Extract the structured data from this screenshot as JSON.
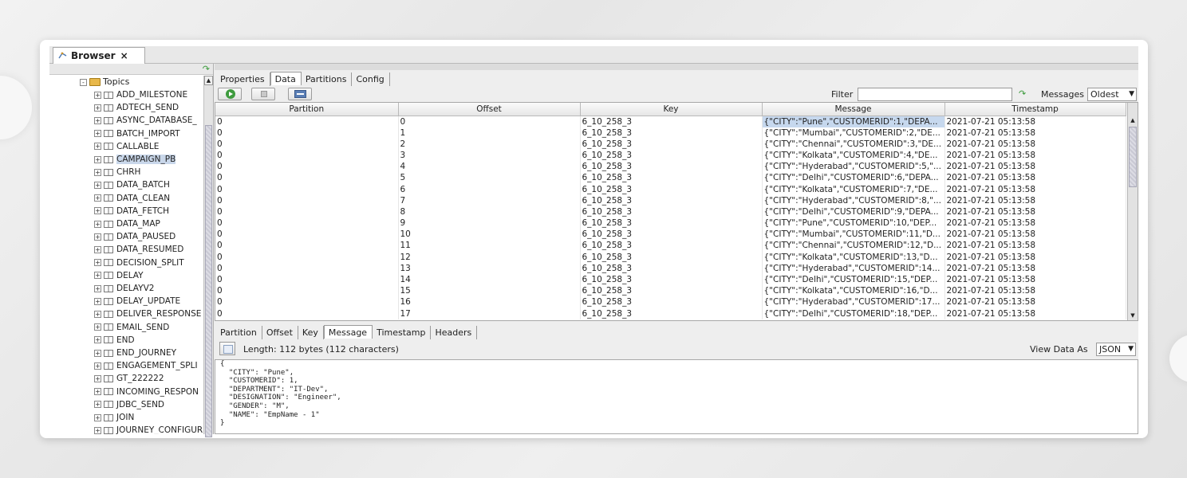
{
  "editor_tab": {
    "title": "Browser",
    "close": "×"
  },
  "tree": {
    "root_label": "Topics",
    "items": [
      "ADD_MILESTONE",
      "ADTECH_SEND",
      "ASYNC_DATABASE_",
      "BATCH_IMPORT",
      "CALLABLE",
      "CAMPAIGN_PB",
      "CHRH",
      "DATA_BATCH",
      "DATA_CLEAN",
      "DATA_FETCH",
      "DATA_MAP",
      "DATA_PAUSED",
      "DATA_RESUMED",
      "DECISION_SPLIT",
      "DELAY",
      "DELAYV2",
      "DELAY_UPDATE",
      "DELIVER_RESPONSE",
      "EMAIL_SEND",
      "END",
      "END_JOURNEY",
      "ENGAGEMENT_SPLI",
      "GT_222222",
      "INCOMING_RESPON",
      "JDBC_SEND",
      "JOIN",
      "JOURNEY_CONFIGUR"
    ],
    "selected": "CAMPAIGN_PB",
    "expander_collapsed": "+",
    "expander_expanded": "-"
  },
  "top_tabs": [
    "Properties",
    "Data",
    "Partitions",
    "Config"
  ],
  "top_active_tab": "Data",
  "filter": {
    "label": "Filter",
    "value": ""
  },
  "messages": {
    "label": "Messages",
    "selected": "Oldest"
  },
  "table": {
    "columns": [
      "Partition",
      "Offset",
      "Key",
      "Message",
      "Timestamp"
    ],
    "rows": [
      [
        "0",
        "0",
        "6_10_258_3",
        "{\"CITY\":\"Pune\",\"CUSTOMERID\":1,\"DEPA...",
        "2021-07-21 05:13:58"
      ],
      [
        "0",
        "1",
        "6_10_258_3",
        "{\"CITY\":\"Mumbai\",\"CUSTOMERID\":2,\"DE...",
        "2021-07-21 05:13:58"
      ],
      [
        "0",
        "2",
        "6_10_258_3",
        "{\"CITY\":\"Chennai\",\"CUSTOMERID\":3,\"DE...",
        "2021-07-21 05:13:58"
      ],
      [
        "0",
        "3",
        "6_10_258_3",
        "{\"CITY\":\"Kolkata\",\"CUSTOMERID\":4,\"DE...",
        "2021-07-21 05:13:58"
      ],
      [
        "0",
        "4",
        "6_10_258_3",
        "{\"CITY\":\"Hyderabad\",\"CUSTOMERID\":5,\"...",
        "2021-07-21 05:13:58"
      ],
      [
        "0",
        "5",
        "6_10_258_3",
        "{\"CITY\":\"Delhi\",\"CUSTOMERID\":6,\"DEPA...",
        "2021-07-21 05:13:58"
      ],
      [
        "0",
        "6",
        "6_10_258_3",
        "{\"CITY\":\"Kolkata\",\"CUSTOMERID\":7,\"DE...",
        "2021-07-21 05:13:58"
      ],
      [
        "0",
        "7",
        "6_10_258_3",
        "{\"CITY\":\"Hyderabad\",\"CUSTOMERID\":8,\"...",
        "2021-07-21 05:13:58"
      ],
      [
        "0",
        "8",
        "6_10_258_3",
        "{\"CITY\":\"Delhi\",\"CUSTOMERID\":9,\"DEPA...",
        "2021-07-21 05:13:58"
      ],
      [
        "0",
        "9",
        "6_10_258_3",
        "{\"CITY\":\"Pune\",\"CUSTOMERID\":10,\"DEP...",
        "2021-07-21 05:13:58"
      ],
      [
        "0",
        "10",
        "6_10_258_3",
        "{\"CITY\":\"Mumbai\",\"CUSTOMERID\":11,\"D...",
        "2021-07-21 05:13:58"
      ],
      [
        "0",
        "11",
        "6_10_258_3",
        "{\"CITY\":\"Chennai\",\"CUSTOMERID\":12,\"D...",
        "2021-07-21 05:13:58"
      ],
      [
        "0",
        "12",
        "6_10_258_3",
        "{\"CITY\":\"Kolkata\",\"CUSTOMERID\":13,\"D...",
        "2021-07-21 05:13:58"
      ],
      [
        "0",
        "13",
        "6_10_258_3",
        "{\"CITY\":\"Hyderabad\",\"CUSTOMERID\":14...",
        "2021-07-21 05:13:58"
      ],
      [
        "0",
        "14",
        "6_10_258_3",
        "{\"CITY\":\"Delhi\",\"CUSTOMERID\":15,\"DEP...",
        "2021-07-21 05:13:58"
      ],
      [
        "0",
        "15",
        "6_10_258_3",
        "{\"CITY\":\"Kolkata\",\"CUSTOMERID\":16,\"D...",
        "2021-07-21 05:13:58"
      ],
      [
        "0",
        "16",
        "6_10_258_3",
        "{\"CITY\":\"Hyderabad\",\"CUSTOMERID\":17...",
        "2021-07-21 05:13:58"
      ],
      [
        "0",
        "17",
        "6_10_258_3",
        "{\"CITY\":\"Delhi\",\"CUSTOMERID\":18,\"DEP...",
        "2021-07-21 05:13:58"
      ]
    ],
    "selected_row": 0
  },
  "detail_tabs": [
    "Partition",
    "Offset",
    "Key",
    "Message",
    "Timestamp",
    "Headers"
  ],
  "detail_active_tab": "Message",
  "length_text": "Length: 112 bytes (112 characters)",
  "view_data_as": {
    "label": "View Data As",
    "selected": "JSON"
  },
  "json_lines": [
    "{",
    "  \"CITY\": \"Pune\",",
    "  \"CUSTOMERID\": 1,",
    "  \"DEPARTMENT\": \"IT-Dev\",",
    "  \"DESIGNATION\": \"Engineer\",",
    "  \"GENDER\": \"M\",",
    "  \"NAME\": \"EmpName - 1\"",
    "}"
  ],
  "colors": {
    "selection": "#c6d8ee",
    "accent_green": "#3e9b3e",
    "folder": "#e8b84a"
  },
  "icons": [
    "browser-tab-icon",
    "refresh-icon",
    "folder-icon",
    "topic-icon",
    "play-icon",
    "stop-icon",
    "grid-view-icon",
    "filter-apply-icon",
    "save-icon",
    "chevron-down-icon"
  ]
}
